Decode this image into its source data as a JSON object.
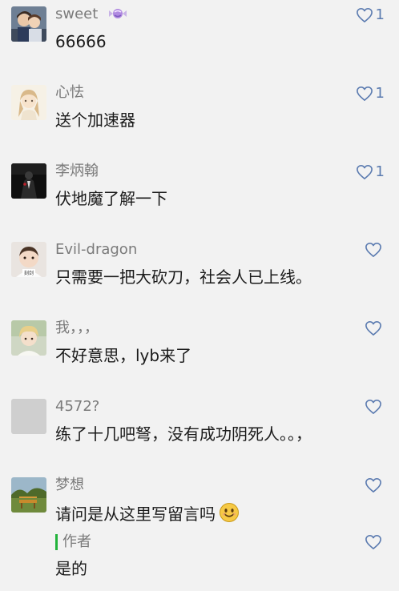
{
  "comments": [
    {
      "name": "sweet",
      "text": "66666",
      "likes": "1",
      "avatar_icon": "couple-photo"
    },
    {
      "name": "心怯",
      "text": "送个加速器",
      "likes": "1",
      "avatar_icon": "anime-girl"
    },
    {
      "name": "李炳翰",
      "text": "伏地魔了解一下",
      "likes": "1",
      "avatar_icon": "suit-figure"
    },
    {
      "name": "Evil-dragon",
      "text": "只需要一把大砍刀，社会人已上线。",
      "likes": "",
      "avatar_icon": "baby-photo"
    },
    {
      "name": "我，，，",
      "text": "不好意思，lyb来了",
      "likes": "",
      "avatar_icon": "blond-man"
    },
    {
      "name": "4572?",
      "text": "练了十几吧弩，没有成功阴死人。。，",
      "likes": "",
      "avatar_icon": "blank-avatar"
    },
    {
      "name": "梦想",
      "text": "请问是从这里写留言吗",
      "likes": "",
      "avatar_icon": "park-bench",
      "emoji": "smiley"
    }
  ],
  "reply": {
    "label": "作者",
    "text": "是的",
    "likes": ""
  },
  "colors": {
    "accent_link": "#5b7bb0",
    "author_bar": "#22b33b"
  }
}
